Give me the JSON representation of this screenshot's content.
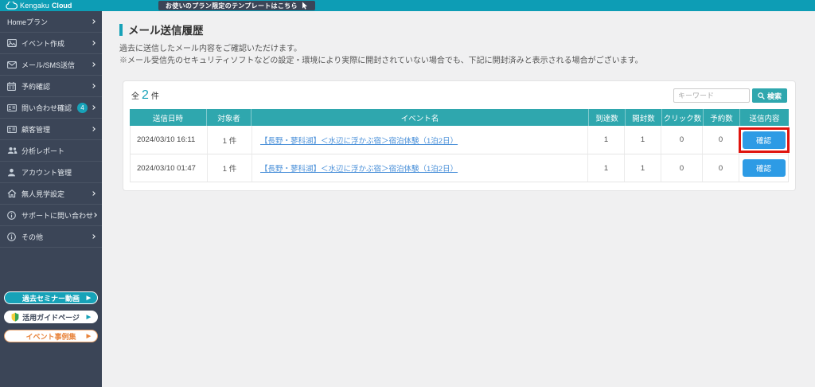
{
  "topbar": {
    "logo": {
      "name_regular": "Kengaku",
      "name_bold": "Cloud"
    },
    "banner_button_label": "お使いのプラン限定のテンプレートはこちら"
  },
  "sidebar": {
    "items": [
      {
        "label": "Homeプラン",
        "icon": "",
        "chevron": true,
        "badge": ""
      },
      {
        "label": "イベント作成",
        "icon": "image-icon",
        "chevron": true,
        "badge": ""
      },
      {
        "label": "メール/SMS送信",
        "icon": "mail-icon",
        "chevron": true,
        "badge": ""
      },
      {
        "label": "予約確認",
        "icon": "calendar-icon",
        "chevron": true,
        "badge": ""
      },
      {
        "label": "問い合わせ確認",
        "icon": "id-card-icon",
        "chevron": true,
        "badge": "4"
      },
      {
        "label": "顧客管理",
        "icon": "id-card-icon",
        "chevron": true,
        "badge": ""
      },
      {
        "label": "分析レポート",
        "icon": "users-icon",
        "chevron": false,
        "badge": ""
      },
      {
        "label": "アカウント管理",
        "icon": "user-icon",
        "chevron": false,
        "badge": ""
      },
      {
        "label": "無人見学設定",
        "icon": "home-icon",
        "chevron": true,
        "badge": ""
      },
      {
        "label": "サポートに問い合わせ",
        "icon": "info-icon",
        "chevron": true,
        "badge": ""
      },
      {
        "label": "その他",
        "icon": "info-icon",
        "chevron": true,
        "badge": ""
      }
    ],
    "footer_buttons": [
      {
        "label": "過去セミナー動画",
        "style": "btn-teal",
        "icon": ""
      },
      {
        "label": "活用ガイドページ",
        "style": "btn-guide",
        "icon": "beginner-mark-icon"
      },
      {
        "label": "イベント事例集",
        "style": "btn-orange",
        "icon": ""
      }
    ]
  },
  "main": {
    "page_title": "メール送信履歴",
    "description_lines": {
      "line1": "過去に送信したメール内容をご確認いただけます。",
      "line2": "※メール受信先のセキュリティソフトなどの設定・環境により実際に開封されていない場合でも、下記に開封済みと表示される場合がございます。"
    },
    "count": {
      "prefix": "全",
      "value": "2",
      "suffix": "件"
    },
    "search": {
      "placeholder": "キーワード",
      "button_label": "検索"
    },
    "table": {
      "headers": [
        "送信日時",
        "対象者",
        "イベント名",
        "到達数",
        "開封数",
        "クリック数",
        "予約数",
        "送信内容"
      ],
      "rows": [
        {
          "sent_at": "2024/03/10 16:11",
          "target_count": "1 件",
          "event_name": "【長野・蓼科湖】＜水辺に浮かぶ宿＞宿泊体験（1泊2日）",
          "delivered": "1",
          "opened": "1",
          "clicks": "0",
          "reservations": "0",
          "action_label": "確認",
          "row_class": "highlighted"
        },
        {
          "sent_at": "2024/03/10 01:47",
          "target_count": "1 件",
          "event_name": "【長野・蓼科湖】＜水辺に浮かぶ宿＞宿泊体験（1泊2日）",
          "delivered": "1",
          "opened": "1",
          "clicks": "0",
          "reservations": "0",
          "action_label": "確認",
          "row_class": ""
        }
      ]
    }
  },
  "colors": {
    "topbar_teal": "#0d9db5",
    "sidebar_navy": "#3b4557",
    "table_header_teal": "#2fa7ae",
    "accent_teal": "#17a2b8",
    "confirm_blue": "#2d9be5",
    "link_blue": "#4a90d9",
    "highlight_red": "#e0140e",
    "guide_orange": "#e8833a"
  }
}
